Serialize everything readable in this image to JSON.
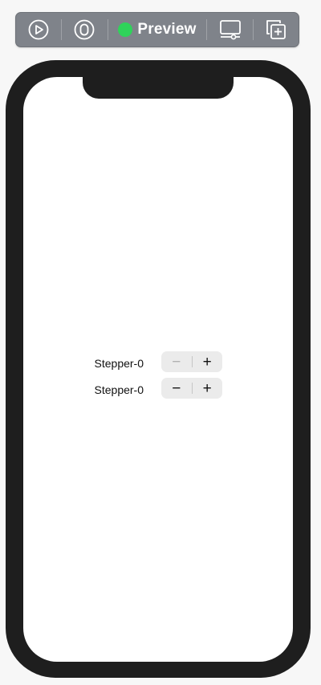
{
  "toolbar": {
    "preview_label": "Preview",
    "status_color": "#2fd35a",
    "icons": [
      "live-preview-icon",
      "select-icon",
      "device-settings-icon",
      "duplicate-icon"
    ]
  },
  "steppers": [
    {
      "label": "Stepper-0",
      "decrement_symbol": "−",
      "increment_symbol": "+",
      "decrement_enabled": false
    },
    {
      "label": "Stepper-0",
      "decrement_symbol": "−",
      "increment_symbol": "+",
      "decrement_enabled": true
    }
  ]
}
